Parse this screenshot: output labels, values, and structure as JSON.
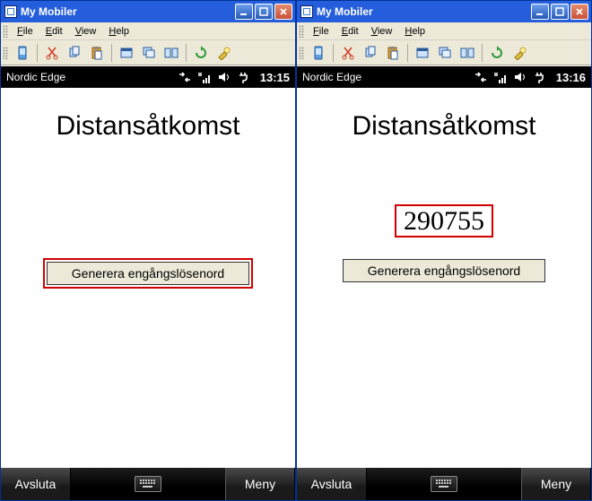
{
  "windows": [
    {
      "title": "My Mobiler",
      "menubar": {
        "file": "File",
        "edit": "Edit",
        "view": "View",
        "help": "Help"
      },
      "device_top": {
        "brand": "Nordic Edge",
        "time": "13:15"
      },
      "content": {
        "heading": "Distansåtkomst",
        "otp": "",
        "button_label": "Generera engångslösenord"
      },
      "softkeys": {
        "left": "Avsluta",
        "right": "Meny"
      }
    },
    {
      "title": "My Mobiler",
      "menubar": {
        "file": "File",
        "edit": "Edit",
        "view": "View",
        "help": "Help"
      },
      "device_top": {
        "brand": "Nordic Edge",
        "time": "13:16"
      },
      "content": {
        "heading": "Distansåtkomst",
        "otp": "290755",
        "button_label": "Generera engångslösenord"
      },
      "softkeys": {
        "left": "Avsluta",
        "right": "Meny"
      }
    }
  ],
  "icon_names": {
    "sync": "sync-icon",
    "signal": "signal-icon",
    "speaker": "speaker-icon",
    "plug": "plug-icon",
    "keyboard": "keyboard-icon"
  }
}
